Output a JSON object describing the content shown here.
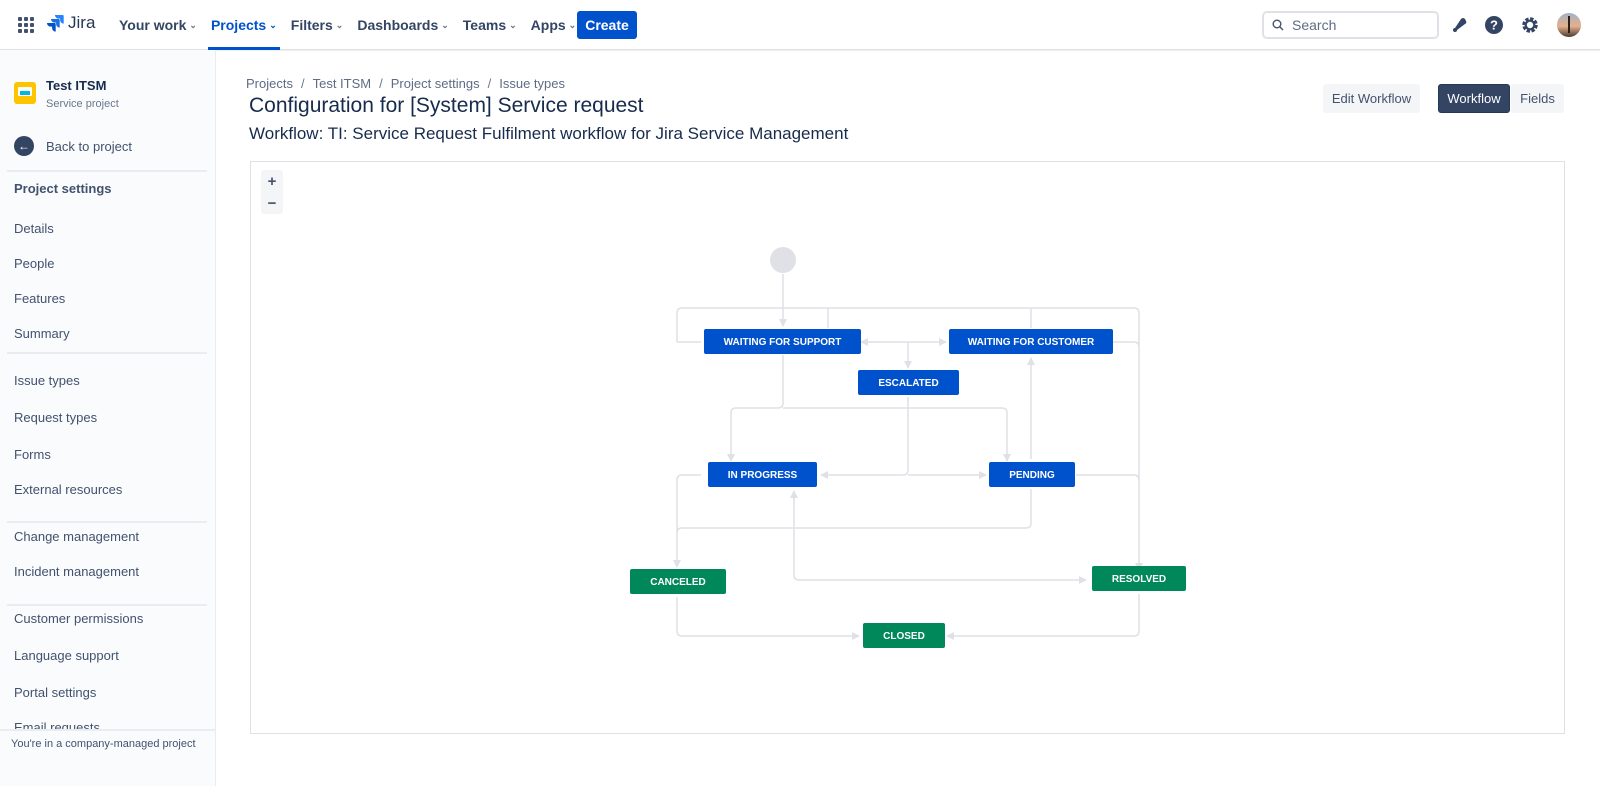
{
  "topbar": {
    "product": "Jira",
    "nav": [
      {
        "label": "Your work",
        "active": false
      },
      {
        "label": "Projects",
        "active": true
      },
      {
        "label": "Filters",
        "active": false
      },
      {
        "label": "Dashboards",
        "active": false
      },
      {
        "label": "Teams",
        "active": false
      },
      {
        "label": "Apps",
        "active": false
      }
    ],
    "create_label": "Create",
    "search_placeholder": "Search",
    "icons": [
      "notifications-icon",
      "help-icon",
      "settings-icon",
      "avatar"
    ]
  },
  "sidebar": {
    "project_name": "Test ITSM",
    "project_type": "Service project",
    "back_label": "Back to project",
    "section_title": "Project settings",
    "groups": [
      [
        "Details",
        "People",
        "Features",
        "Summary"
      ],
      [
        "Issue types",
        "Request types",
        "Forms",
        "External resources"
      ],
      [
        "Change management",
        "Incident management"
      ],
      [
        "Customer permissions",
        "Language support",
        "Portal settings",
        "Email requests"
      ]
    ],
    "footer": "You're in a company-managed project"
  },
  "breadcrumb": [
    "Projects",
    "Test ITSM",
    "Project settings",
    "Issue types"
  ],
  "page": {
    "title": "Configuration for [System] Service request",
    "subtitle": "Workflow: TI: Service Request Fulfilment workflow for Jira Service Management",
    "edit_workflow_label": "Edit Workflow",
    "view_toggle": [
      {
        "label": "Workflow",
        "selected": true
      },
      {
        "label": "Fields",
        "selected": false
      }
    ]
  },
  "diagram": {
    "zoom_in": "+",
    "zoom_out": "−",
    "colors": {
      "in_progress_category": "#0052cc",
      "done_category": "#00875a",
      "start": "#dfe1e6",
      "edge": "#dfe1e6"
    },
    "statuses": [
      {
        "id": "wfs",
        "label": "WAITING FOR SUPPORT",
        "category": "in_progress"
      },
      {
        "id": "wfc",
        "label": "WAITING FOR CUSTOMER",
        "category": "in_progress"
      },
      {
        "id": "esc",
        "label": "ESCALATED",
        "category": "in_progress"
      },
      {
        "id": "inp",
        "label": "IN PROGRESS",
        "category": "in_progress"
      },
      {
        "id": "pen",
        "label": "PENDING",
        "category": "in_progress"
      },
      {
        "id": "can",
        "label": "CANCELED",
        "category": "done"
      },
      {
        "id": "res",
        "label": "RESOLVED",
        "category": "done"
      },
      {
        "id": "clo",
        "label": "CLOSED",
        "category": "done"
      }
    ]
  }
}
